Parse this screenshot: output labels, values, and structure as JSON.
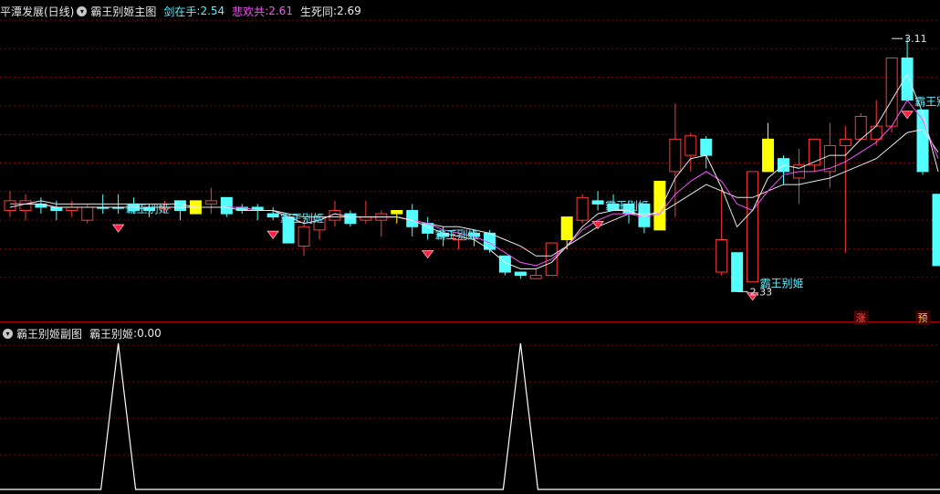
{
  "main_panel": {
    "title": "平潭发展(日线)",
    "indicator_name": "霸王别姬主图",
    "lines": [
      {
        "label": "剑在手",
        "value": "2.54",
        "color": "#e8e8e8"
      },
      {
        "label": "悲欢共",
        "value": "2.61",
        "color": "#ff50ff"
      },
      {
        "label": "生死同",
        "value": "2.69",
        "color": "#e8e8e8"
      }
    ],
    "high_label": "3.11",
    "low_label": "2.33",
    "signal_text": "霸王别姬",
    "badge_zhang": "涨",
    "badge_yu": "预"
  },
  "sub_panel": {
    "indicator_name": "霸王别姬副图",
    "value_label": "霸王别姬",
    "value": "0.00"
  },
  "colors": {
    "up": "#ff3b3b",
    "down": "#54ffff",
    "signal": "#ffff00",
    "ma_white": "#e8e8e8",
    "ma_magenta": "#ff50ff",
    "grid": "#8a0000",
    "separator": "#b00000",
    "text_cyan": "#5ff0ff"
  },
  "chart_data": {
    "type": "candlestick",
    "price_range": [
      2.3,
      3.15
    ],
    "candles": [
      [
        2.61,
        2.58,
        2.64,
        2.56,
        "u"
      ],
      [
        2.61,
        2.58,
        2.63,
        2.55,
        "u"
      ],
      [
        2.6,
        2.59,
        2.62,
        2.57,
        "d"
      ],
      [
        2.59,
        2.58,
        2.61,
        2.55,
        "d"
      ],
      [
        2.58,
        2.59,
        2.61,
        2.56,
        "u"
      ],
      [
        2.55,
        2.59,
        2.6,
        2.54,
        "u"
      ],
      [
        2.59,
        2.59,
        2.63,
        2.57,
        "d"
      ],
      [
        2.59,
        2.59,
        2.63,
        2.57,
        "d"
      ],
      [
        2.6,
        2.58,
        2.62,
        2.57,
        "d"
      ],
      [
        2.59,
        2.58,
        2.6,
        2.56,
        "d"
      ],
      [
        2.59,
        2.59,
        2.61,
        2.57,
        "u"
      ],
      [
        2.61,
        2.58,
        2.61,
        2.55,
        "d"
      ],
      [
        2.57,
        2.61,
        2.61,
        2.57,
        "s"
      ],
      [
        2.6,
        2.61,
        2.65,
        2.57,
        "u"
      ],
      [
        2.62,
        2.57,
        2.62,
        2.56,
        "d"
      ],
      [
        2.59,
        2.58,
        2.6,
        2.57,
        "d"
      ],
      [
        2.59,
        2.58,
        2.6,
        2.55,
        "d"
      ],
      [
        2.56,
        2.57,
        2.59,
        2.55,
        "d"
      ],
      [
        2.56,
        2.48,
        2.56,
        2.48,
        "d"
      ],
      [
        2.47,
        2.53,
        2.55,
        2.44,
        "u"
      ],
      [
        2.52,
        2.56,
        2.57,
        2.49,
        "u"
      ],
      [
        2.55,
        2.58,
        2.61,
        2.53,
        "u"
      ],
      [
        2.57,
        2.54,
        2.58,
        2.53,
        "d"
      ],
      [
        2.55,
        2.56,
        2.61,
        2.54,
        "u"
      ],
      [
        2.55,
        2.57,
        2.58,
        2.5,
        "u"
      ],
      [
        2.57,
        2.58,
        2.58,
        2.54,
        "s"
      ],
      [
        2.58,
        2.53,
        2.6,
        2.5,
        "d"
      ],
      [
        2.54,
        2.51,
        2.56,
        2.49,
        "d"
      ],
      [
        2.51,
        2.5,
        2.53,
        2.47,
        "d"
      ],
      [
        2.49,
        2.52,
        2.52,
        2.46,
        "u"
      ],
      [
        2.51,
        2.5,
        2.52,
        2.47,
        "d"
      ],
      [
        2.51,
        2.46,
        2.52,
        2.45,
        "d"
      ],
      [
        2.44,
        2.39,
        2.44,
        2.38,
        "d"
      ],
      [
        2.39,
        2.38,
        2.39,
        2.37,
        "d"
      ],
      [
        2.37,
        2.38,
        2.4,
        2.37,
        "u"
      ],
      [
        2.38,
        2.48,
        2.48,
        2.38,
        "u"
      ],
      [
        2.49,
        2.56,
        2.56,
        2.46,
        "s"
      ],
      [
        2.55,
        2.62,
        2.63,
        2.54,
        "u"
      ],
      [
        2.61,
        2.6,
        2.64,
        2.58,
        "d"
      ],
      [
        2.58,
        2.6,
        2.63,
        2.58,
        "d"
      ],
      [
        2.6,
        2.57,
        2.61,
        2.54,
        "d"
      ],
      [
        2.6,
        2.53,
        2.6,
        2.51,
        "d"
      ],
      [
        2.52,
        2.67,
        2.67,
        2.52,
        "s"
      ],
      [
        2.7,
        2.8,
        2.91,
        2.56,
        "u"
      ],
      [
        2.75,
        2.81,
        2.82,
        2.7,
        "u"
      ],
      [
        2.8,
        2.75,
        2.81,
        2.71,
        "d"
      ],
      [
        2.39,
        2.49,
        2.65,
        2.38,
        "u"
      ],
      [
        2.45,
        2.33,
        2.45,
        2.33,
        "d"
      ],
      [
        2.36,
        2.7,
        2.7,
        2.36,
        "u"
      ],
      [
        2.7,
        2.8,
        2.85,
        2.7,
        "s"
      ],
      [
        2.74,
        2.7,
        2.75,
        2.66,
        "d"
      ],
      [
        2.68,
        2.72,
        2.77,
        2.6,
        "u"
      ],
      [
        2.72,
        2.8,
        2.8,
        2.7,
        "u"
      ],
      [
        2.7,
        2.78,
        2.85,
        2.65,
        "u"
      ],
      [
        2.78,
        2.8,
        2.84,
        2.45,
        "u"
      ],
      [
        2.8,
        2.87,
        2.88,
        2.8,
        "u"
      ],
      [
        2.8,
        2.84,
        2.92,
        2.78,
        "u"
      ],
      [
        2.84,
        3.05,
        3.05,
        2.82,
        "u"
      ],
      [
        3.05,
        2.92,
        3.11,
        2.92,
        "d"
      ],
      [
        2.89,
        2.7,
        2.89,
        2.69,
        "d"
      ],
      [
        2.63,
        2.41,
        2.63,
        2.41,
        "d"
      ]
    ],
    "ma_white": [
      2.6,
      2.6,
      2.61,
      2.6,
      2.6,
      2.6,
      2.6,
      2.6,
      2.6,
      2.6,
      2.6,
      2.6,
      2.59,
      2.59,
      2.59,
      2.59,
      2.58,
      2.58,
      2.57,
      2.56,
      2.56,
      2.56,
      2.56,
      2.56,
      2.56,
      2.56,
      2.55,
      2.54,
      2.53,
      2.53,
      2.52,
      2.51,
      2.49,
      2.47,
      2.44,
      2.44,
      2.47,
      2.5,
      2.53,
      2.55,
      2.57,
      2.57,
      2.57,
      2.6,
      2.63,
      2.66,
      2.64,
      2.62,
      2.62,
      2.64,
      2.66,
      2.66,
      2.67,
      2.68,
      2.7,
      2.72,
      2.74,
      2.78,
      2.82,
      2.83,
      2.76
    ],
    "ma_magenta": [
      2.6,
      2.6,
      2.6,
      2.59,
      2.59,
      2.59,
      2.59,
      2.59,
      2.59,
      2.59,
      2.59,
      2.59,
      2.59,
      2.59,
      2.59,
      2.59,
      2.58,
      2.58,
      2.56,
      2.54,
      2.55,
      2.57,
      2.56,
      2.56,
      2.56,
      2.56,
      2.55,
      2.54,
      2.52,
      2.51,
      2.5,
      2.48,
      2.45,
      2.42,
      2.41,
      2.43,
      2.47,
      2.52,
      2.55,
      2.57,
      2.57,
      2.56,
      2.57,
      2.63,
      2.67,
      2.7,
      2.67,
      2.6,
      2.58,
      2.64,
      2.69,
      2.7,
      2.7,
      2.71,
      2.73,
      2.76,
      2.79,
      2.84,
      2.92,
      2.86,
      2.74
    ],
    "ma_white2": [
      2.59,
      2.6,
      2.6,
      2.59,
      2.59,
      2.59,
      2.59,
      2.59,
      2.59,
      2.59,
      2.59,
      2.59,
      2.59,
      2.59,
      2.59,
      2.58,
      2.58,
      2.58,
      2.56,
      2.54,
      2.55,
      2.57,
      2.56,
      2.56,
      2.56,
      2.56,
      2.55,
      2.53,
      2.51,
      2.5,
      2.49,
      2.46,
      2.42,
      2.4,
      2.4,
      2.42,
      2.47,
      2.53,
      2.57,
      2.58,
      2.58,
      2.56,
      2.58,
      2.68,
      2.74,
      2.75,
      2.65,
      2.53,
      2.58,
      2.68,
      2.72,
      2.71,
      2.73,
      2.75,
      2.75,
      2.8,
      2.84,
      2.92,
      3.0,
      2.88,
      2.7
    ],
    "signal_candles": [
      7,
      17,
      27,
      38,
      48,
      58
    ],
    "sub_signal_peaks": [
      7,
      33
    ]
  }
}
